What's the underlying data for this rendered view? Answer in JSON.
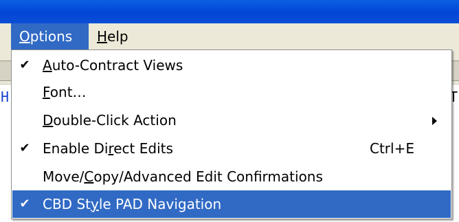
{
  "menubar": {
    "options": {
      "pre": "",
      "key": "O",
      "post": "ptions"
    },
    "help": {
      "pre": "",
      "key": "H",
      "post": "elp"
    }
  },
  "background_peek": {
    "left_glyph": "H",
    "right_glyph": "T"
  },
  "menu": {
    "items": [
      {
        "checked": true,
        "pre": "",
        "key": "A",
        "post": "uto-Contract Views",
        "shortcut": "",
        "submenu": false,
        "selected": false
      },
      {
        "checked": false,
        "pre": "",
        "key": "F",
        "post": "ont…",
        "shortcut": "",
        "submenu": false,
        "selected": false
      },
      {
        "checked": false,
        "pre": "",
        "key": "D",
        "post": "ouble-Click Action",
        "shortcut": "",
        "submenu": true,
        "selected": false
      },
      {
        "checked": true,
        "pre": "Enable Di",
        "key": "r",
        "post": "ect Edits",
        "shortcut": "Ctrl+E",
        "submenu": false,
        "selected": false
      },
      {
        "checked": false,
        "pre": "Move/",
        "key": "C",
        "post": "opy/Advanced Edit Confirmations",
        "shortcut": "",
        "submenu": false,
        "selected": false
      },
      {
        "checked": true,
        "pre": "CBD St",
        "key": "y",
        "post": "le PAD Navigation",
        "shortcut": "",
        "submenu": false,
        "selected": true
      }
    ],
    "check_glyph": "✔"
  },
  "colors": {
    "highlight": "#316ac5",
    "titlebar": "#0245d8",
    "menubar_bg": "#ece9d8"
  }
}
